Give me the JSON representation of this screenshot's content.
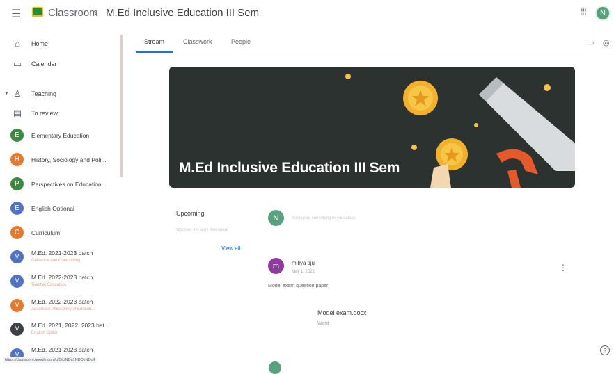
{
  "header": {
    "app_name": "Classroom",
    "separator": "›",
    "course_title": "M.Ed Inclusive Education III Sem",
    "avatar_letter": "N"
  },
  "sidebar": {
    "home": "Home",
    "calendar": "Calendar",
    "teaching": "Teaching",
    "to_review": "To review",
    "classes": [
      {
        "letter": "E",
        "name": "Elementary Education",
        "sub": "",
        "color": "#3a8a3f"
      },
      {
        "letter": "H",
        "name": "History, Sociology and Poli...",
        "sub": "",
        "color": "#e6792b"
      },
      {
        "letter": "P",
        "name": "Perspectives on Education...",
        "sub": "",
        "color": "#3a8a3f"
      },
      {
        "letter": "E",
        "name": "English Optional",
        "sub": "",
        "color": "#4f73c9"
      },
      {
        "letter": "C",
        "name": "Curriculum",
        "sub": "",
        "color": "#e6792b"
      },
      {
        "letter": "M",
        "name": "M.Ed. 2021-2023 batch",
        "sub": "Guidance and Counselling",
        "color": "#4f73c9"
      },
      {
        "letter": "M",
        "name": "M.Ed. 2022-2023 batch",
        "sub": "Teacher Education",
        "color": "#4f73c9"
      },
      {
        "letter": "M",
        "name": "M.Ed. 2022-2023 batch",
        "sub": "Advanced Philosophy of Educati...",
        "color": "#e6792b"
      },
      {
        "letter": "M",
        "name": "M.Ed. 2021, 2022, 2023 bat...",
        "sub": "English Option",
        "color": "#3c4043"
      },
      {
        "letter": "M",
        "name": "M.Ed. 2021-2023 batch",
        "sub": "",
        "color": "#4f73c9"
      }
    ]
  },
  "tabs": [
    "Stream",
    "Classwork",
    "People"
  ],
  "banner": {
    "title": "M.Ed Inclusive Education III Sem"
  },
  "upcoming": {
    "title": "Upcoming",
    "text": "Woohoo, no work due soon!",
    "view_all": "View all"
  },
  "announce": {
    "avatar_letter": "N",
    "placeholder": "Announce something to your class"
  },
  "post": {
    "avatar_letter": "m",
    "author": "miliya tiju",
    "date": "May 1, 2022",
    "body": "Model exam question paper",
    "attachment_name": "Model exam.docx",
    "attachment_type": "Word"
  },
  "status_url": "https://classroom.google.com/u/0/c/NDg1NDQzNDc4"
}
